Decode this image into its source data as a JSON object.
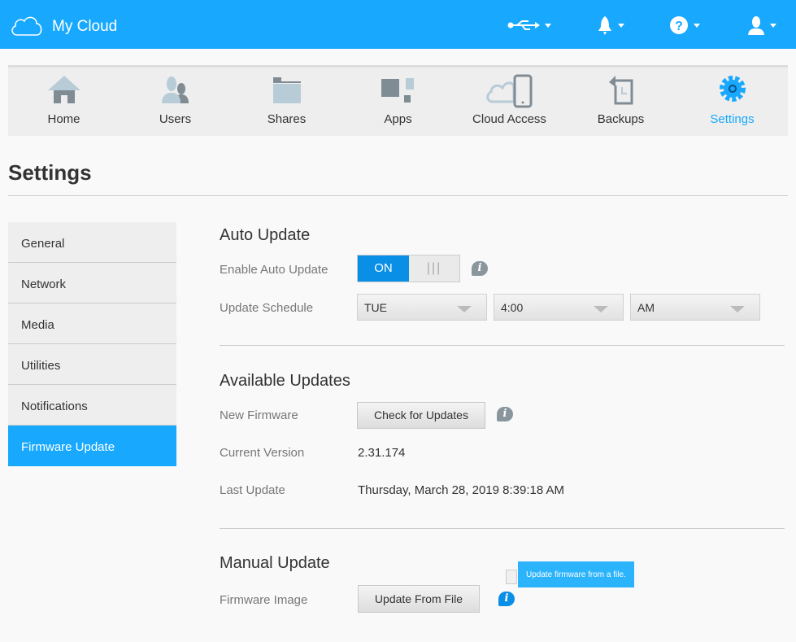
{
  "header": {
    "app_name": "My Cloud",
    "icons": [
      "usb-icon",
      "bell-icon",
      "help-icon",
      "user-icon"
    ]
  },
  "nav": {
    "tabs": [
      {
        "label": "Home"
      },
      {
        "label": "Users"
      },
      {
        "label": "Shares"
      },
      {
        "label": "Apps"
      },
      {
        "label": "Cloud Access"
      },
      {
        "label": "Backups"
      },
      {
        "label": "Settings"
      }
    ],
    "active": "Settings"
  },
  "page_title": "Settings",
  "sidebar": {
    "items": [
      {
        "label": "General"
      },
      {
        "label": "Network"
      },
      {
        "label": "Media"
      },
      {
        "label": "Utilities"
      },
      {
        "label": "Notifications"
      },
      {
        "label": "Firmware Update"
      }
    ],
    "active": "Firmware Update"
  },
  "auto_update": {
    "heading": "Auto Update",
    "enable_label": "Enable Auto Update",
    "toggle_on": "ON",
    "schedule_label": "Update Schedule",
    "day": "TUE",
    "time": "4:00",
    "ampm": "AM"
  },
  "available": {
    "heading": "Available Updates",
    "new_firmware_label": "New Firmware",
    "check_button": "Check for Updates",
    "current_version_label": "Current Version",
    "current_version": "2.31.174",
    "last_update_label": "Last Update",
    "last_update": "Thursday, March 28, 2019 8:39:18 AM"
  },
  "manual": {
    "heading": "Manual Update",
    "firmware_image_label": "Firmware Image",
    "update_button": "Update From File",
    "tooltip": "Update firmware from a file."
  },
  "colors": {
    "accent": "#18a9fe",
    "toggle": "#0a8fe6"
  }
}
